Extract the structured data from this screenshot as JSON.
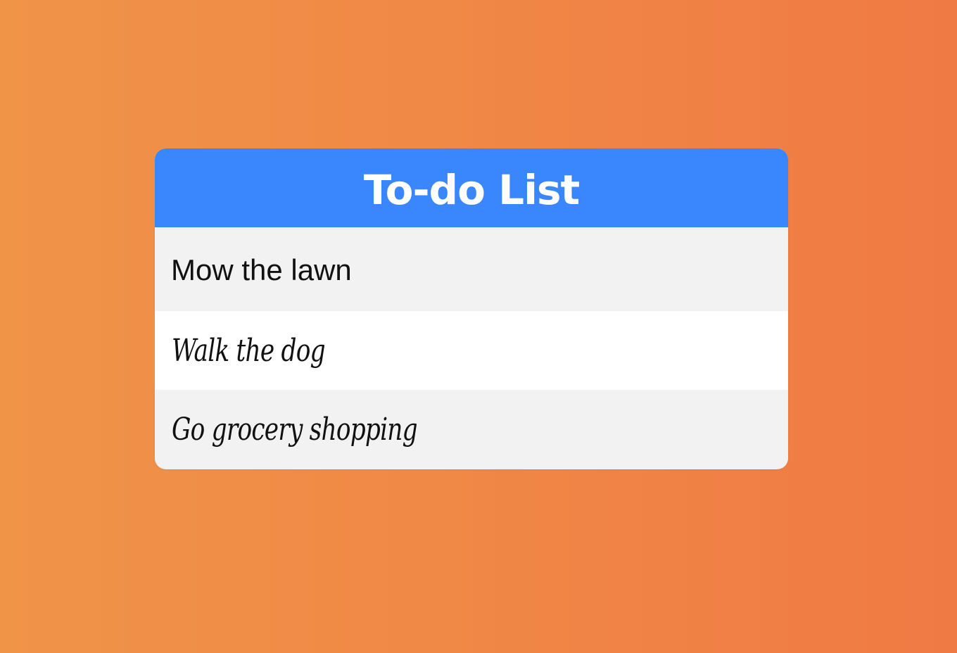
{
  "card": {
    "title": "To-do List"
  },
  "new_item": {
    "value": "Mow the lawn"
  },
  "items": [
    {
      "label": "Walk the dog"
    },
    {
      "label": "Go grocery shopping"
    }
  ],
  "colors": {
    "header": "#3a87fd",
    "background_start": "#f09448",
    "background_end": "#f07a44",
    "row_light": "#ffffff",
    "row_gray": "#f2f2f2"
  }
}
